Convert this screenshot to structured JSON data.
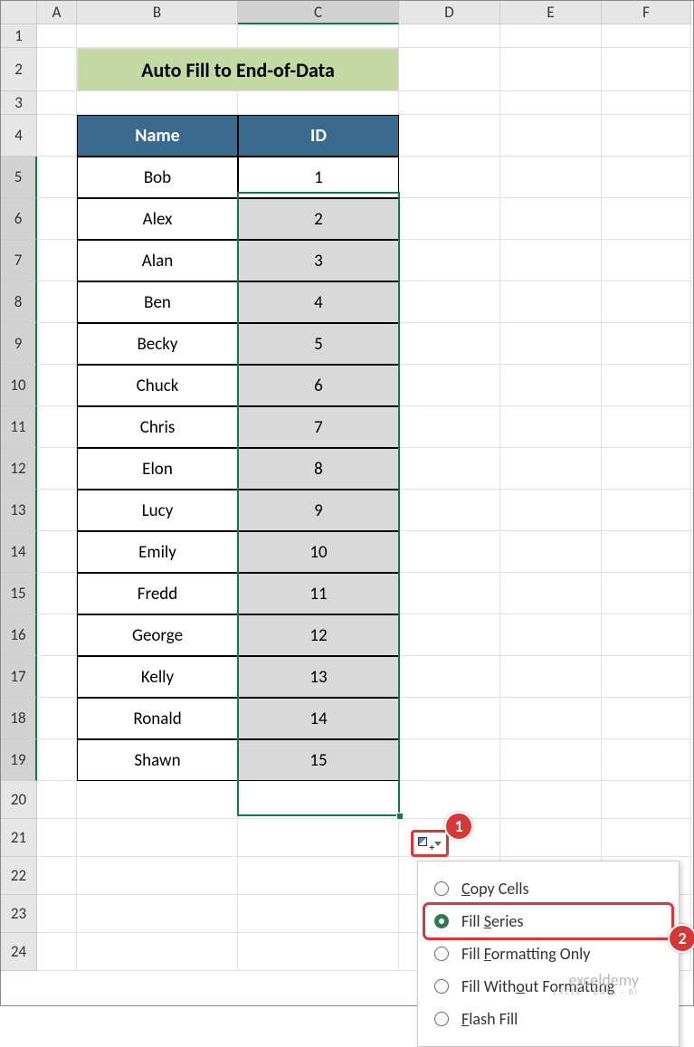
{
  "columns": [
    "A",
    "B",
    "C",
    "D",
    "E",
    "F"
  ],
  "rows": [
    "1",
    "2",
    "3",
    "4",
    "5",
    "6",
    "7",
    "8",
    "9",
    "10",
    "11",
    "12",
    "13",
    "14",
    "15",
    "16",
    "17",
    "18",
    "19",
    "20",
    "21",
    "22",
    "23",
    "24"
  ],
  "title": "Auto Fill to End-of-Data",
  "table": {
    "headers": {
      "name": "Name",
      "id": "ID"
    },
    "rows": [
      {
        "name": "Bob",
        "id": "1"
      },
      {
        "name": "Alex",
        "id": "2"
      },
      {
        "name": "Alan",
        "id": "3"
      },
      {
        "name": "Ben",
        "id": "4"
      },
      {
        "name": "Becky",
        "id": "5"
      },
      {
        "name": "Chuck",
        "id": "6"
      },
      {
        "name": "Chris",
        "id": "7"
      },
      {
        "name": "Elon",
        "id": "8"
      },
      {
        "name": "Lucy",
        "id": "9"
      },
      {
        "name": "Emily",
        "id": "10"
      },
      {
        "name": "Fredd",
        "id": "11"
      },
      {
        "name": "George",
        "id": "12"
      },
      {
        "name": "Kelly",
        "id": "13"
      },
      {
        "name": "Ronald",
        "id": "14"
      },
      {
        "name": "Shawn",
        "id": "15"
      }
    ]
  },
  "autofill_menu": {
    "items": [
      {
        "key": "copy",
        "label_pre": "",
        "u": "C",
        "label_post": "opy Cells",
        "selected": false
      },
      {
        "key": "series",
        "label_pre": "Fill ",
        "u": "S",
        "label_post": "eries",
        "selected": true
      },
      {
        "key": "fmt",
        "label_pre": "Fill ",
        "u": "F",
        "label_post": "ormatting Only",
        "selected": false
      },
      {
        "key": "nofmt",
        "label_pre": "Fill With",
        "u": "o",
        "label_post": "ut Formatting",
        "selected": false
      },
      {
        "key": "flash",
        "label_pre": "",
        "u": "F",
        "label_post": "lash Fill",
        "selected": false
      }
    ]
  },
  "callouts": {
    "one": "1",
    "two": "2"
  },
  "watermark": {
    "brand": "exceldemy",
    "tag": "EXCEL · DATA · BI"
  }
}
